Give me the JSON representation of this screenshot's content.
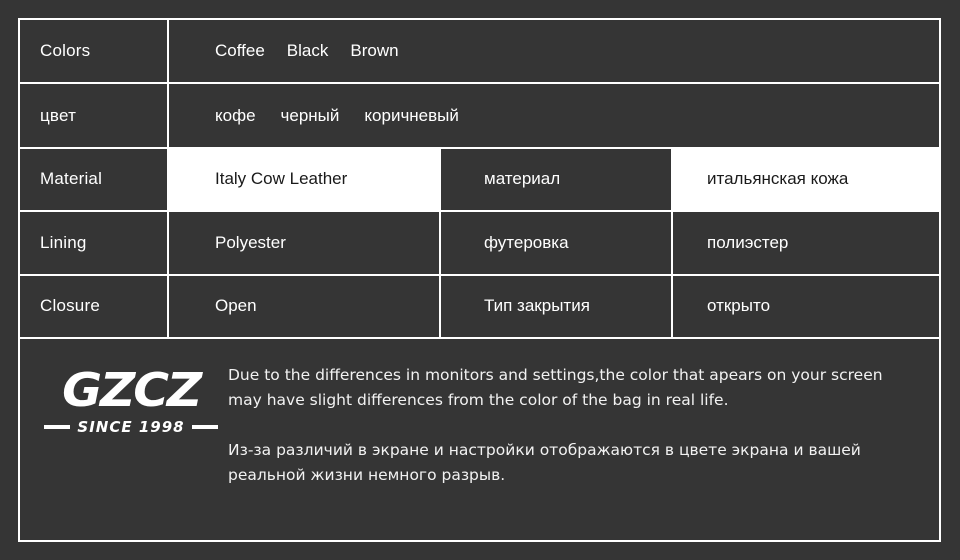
{
  "colors": {
    "background": "#353535",
    "border": "#ffffff",
    "text": "#ffffff",
    "highlight_background": "#ffffff",
    "highlight_text": "#1a1a1a"
  },
  "spec_table": {
    "rows": [
      {
        "label_en": "Colors",
        "values_en": [
          "Coffee",
          "Black",
          "Brown"
        ]
      },
      {
        "label_ru": "цвет",
        "values_ru": [
          "кофе",
          "черный",
          "коричневый"
        ]
      },
      {
        "label_en": "Material",
        "value_en": "Italy Cow Leather",
        "label_ru": "материал",
        "value_ru": "итальянская кожа",
        "highlighted": true
      },
      {
        "label_en": "Lining",
        "value_en": "Polyester",
        "label_ru": "футеровка",
        "value_ru": "полиэстер",
        "highlighted": false
      },
      {
        "label_en": "Closure",
        "value_en": "Open",
        "label_ru": "Тип закрытия",
        "value_ru": "открыто",
        "highlighted": false
      }
    ]
  },
  "footer": {
    "logo": {
      "brand": "GZCZ",
      "since": "SINCE 1998"
    },
    "disclaimer_en": "Due to the differences in monitors and settings,the color that apears on your screen may have slight differences from the color of the bag in real life.",
    "disclaimer_ru": "Из-за различий в экране и настройки отображаются в цвете экрана и вашей реальной жизни немного разрыв."
  }
}
